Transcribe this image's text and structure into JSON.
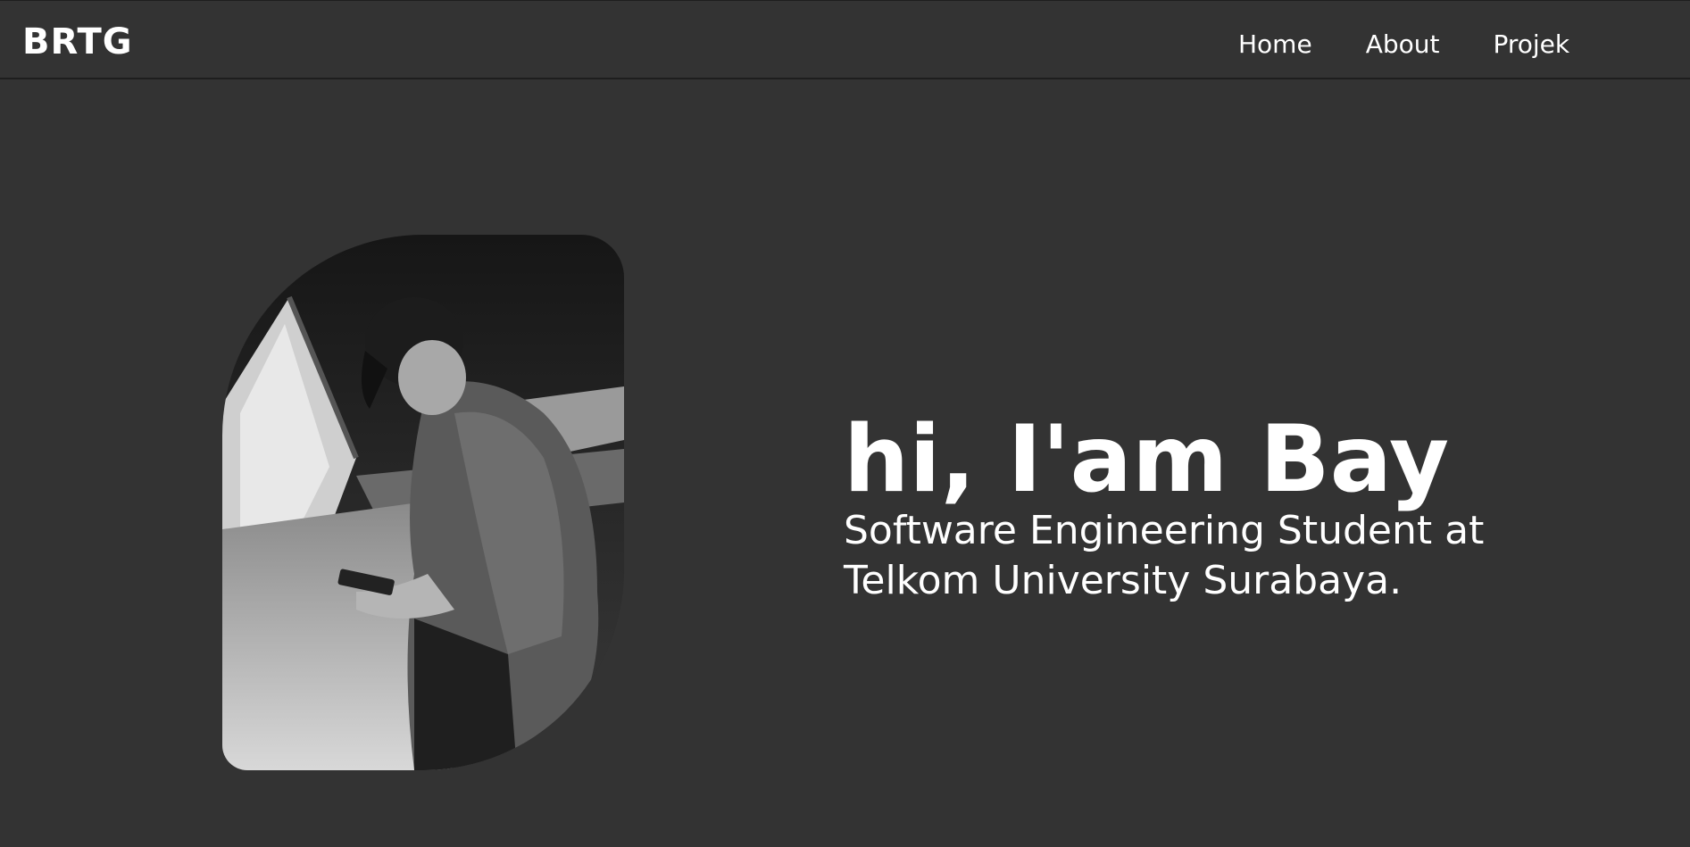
{
  "navbar": {
    "brand": "BRTG",
    "links": [
      {
        "label": "Home"
      },
      {
        "label": "About"
      },
      {
        "label": "Projek"
      }
    ]
  },
  "hero": {
    "title": "hi, I'am Bay",
    "subtitle": "Software Engineering Student at Telkom University Surabaya."
  },
  "colors": {
    "background": "#333333",
    "text": "#ffffff",
    "border": "#1e1e1e"
  }
}
